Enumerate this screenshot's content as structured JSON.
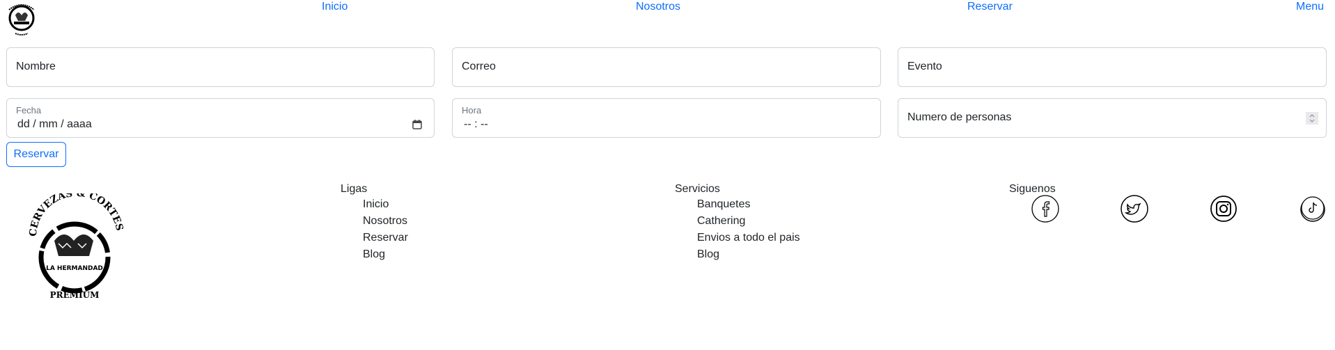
{
  "header": {
    "logo_text": "CERVEZAS & CORTES LA HERMANDAD PRÉMIUM",
    "nav": [
      {
        "label": "Inicio"
      },
      {
        "label": "Nosotros"
      },
      {
        "label": "Reservar"
      },
      {
        "label": "Menu"
      }
    ],
    "link_color": "#0d6efd"
  },
  "form": {
    "nombre": {
      "placeholder": "Nombre"
    },
    "correo": {
      "placeholder": "Correo"
    },
    "evento": {
      "placeholder": "Evento"
    },
    "fecha": {
      "label": "Fecha",
      "value": "dd / mm / aaaa"
    },
    "hora": {
      "label": "Hora",
      "value": "-- : --"
    },
    "personas": {
      "placeholder": "Numero de personas"
    },
    "submit_label": "Reservar"
  },
  "footer": {
    "logo_text": "CERVEZAS & CORTES LA HERMANDAD PRÉMIUM",
    "ligas": {
      "title": "Ligas",
      "items": [
        "Inicio",
        "Nosotros",
        "Reservar",
        "Blog"
      ]
    },
    "servicios": {
      "title": "Servicios",
      "items": [
        "Banquetes",
        "Cathering",
        "Envios a todo el pais",
        "Blog"
      ]
    },
    "siguenos": {
      "title": "Siguenos",
      "icons": [
        "facebook-icon",
        "twitter-icon",
        "instagram-icon",
        "tiktok-icon"
      ]
    }
  }
}
